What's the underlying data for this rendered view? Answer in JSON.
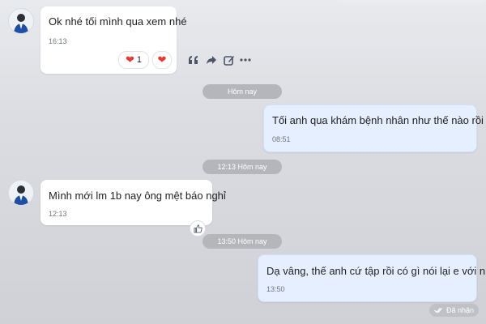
{
  "messages": [
    {
      "text": "Ok nhé tối mình qua xem nhé",
      "time": "16:13",
      "reaction_count": "1"
    },
    {
      "text": "Tối anh qua khám bệnh nhân như thế nào rồi ạ?",
      "time": "08:51"
    },
    {
      "text": "Mình mới lm 1b nay ông mệt báo nghỉ",
      "time": "12:13"
    },
    {
      "text": "Dạ vâng, thế anh cứ tập rồi có gì nói lại e với nha.",
      "time": "13:50"
    }
  ],
  "separators": [
    "Hôm nay",
    "12:13 Hôm nay",
    "13:50 Hôm nay"
  ],
  "status": {
    "label": "Đã nhận"
  },
  "icons": [
    "heart-icon",
    "quote-icon",
    "forward-icon",
    "edit-icon",
    "more-icon",
    "like-icon",
    "double-check-icon"
  ],
  "colors": {
    "outgoing_bubble": "#e6efff",
    "incoming_bubble": "#ffffff",
    "separator": "#b4b6ba"
  }
}
